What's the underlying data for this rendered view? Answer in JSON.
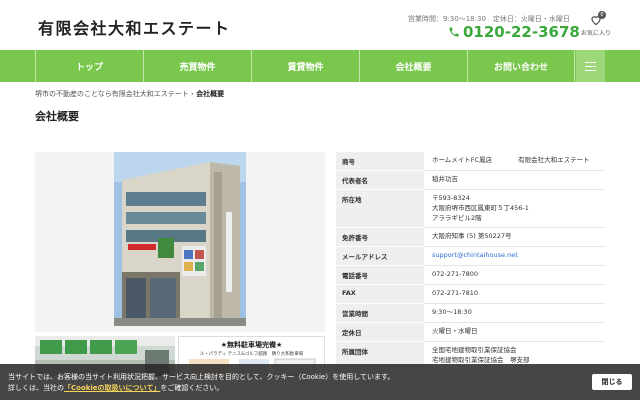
{
  "header": {
    "logo": "有限会社大和エステート",
    "hours": "営業時間：9:30～18:30　定休日：火曜日・水曜日",
    "phone": "0120-22-3678",
    "favorites_label": "お気に入り",
    "favorites_count": "0"
  },
  "nav": {
    "items": [
      {
        "label": "トップ"
      },
      {
        "label": "売買物件"
      },
      {
        "label": "賃貸物件"
      },
      {
        "label": "会社概要"
      },
      {
        "label": "お問い合わせ"
      }
    ]
  },
  "breadcrumb": {
    "home": "堺市の不動産のことなら有限会社大和エステート",
    "separator": "›",
    "current": "会社概要"
  },
  "page_title": "会社概要",
  "flyer": {
    "title": "★無料駐車場完備★",
    "subtitle": "ル・パラディ テニス&ゴルフ越路　隣り大和駐車場"
  },
  "company_info": [
    {
      "label": "商号",
      "value": "ホームメイトFC鳳店　　　　有限会社大和エステート"
    },
    {
      "label": "代表者名",
      "value": "稲井功吉"
    },
    {
      "label": "所在地",
      "value": "〒593-8324\n大阪府堺市西区鳳東町５丁456-1\nアララギビル2階"
    },
    {
      "label": "免許番号",
      "value": "大阪府知事 (5) 第50227号"
    },
    {
      "label": "メールアドレス",
      "value": "support@chintaihouse.net",
      "link": true
    },
    {
      "label": "電話番号",
      "value": "072-271-7800"
    },
    {
      "label": "FAX",
      "value": "072-271-7810"
    },
    {
      "label": "営業時間",
      "value": "9:30～18:30"
    },
    {
      "label": "定休日",
      "value": "火曜日・水曜日"
    },
    {
      "label": "所属団体",
      "value": "全国宅地建物取引業保証協会\n宅地建物取引業保証協会　堺支部"
    }
  ],
  "cookie": {
    "line1": "当サイトでは、お客様の当サイト利用状況把握、サービス向上検討を目的として、クッキー（Cookie）を使用しています。",
    "line2_pre": "詳しくは、当社の",
    "line2_link": "「Cookieの取扱いについて」",
    "line2_post": "をご確認ください。",
    "close_label": "閉じる"
  },
  "colors": {
    "brand_green": "#79c84d",
    "phone_green": "#3aa93a",
    "link_blue": "#2a6fd6"
  }
}
